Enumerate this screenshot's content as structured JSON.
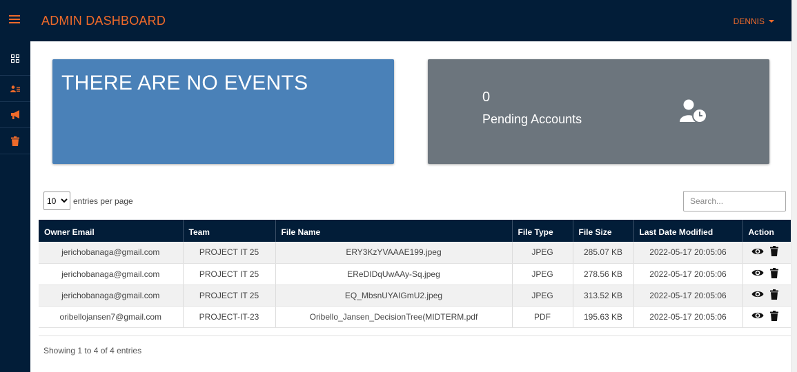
{
  "header": {
    "title": "ADMIN DASHBOARD",
    "user": "DENNIS"
  },
  "sidebar": {
    "items": [
      {
        "icon": "grid-icon"
      },
      {
        "icon": "user-list-icon"
      },
      {
        "icon": "megaphone-icon"
      },
      {
        "icon": "trash-icon"
      }
    ]
  },
  "events_card": {
    "text": "THERE ARE NO EVENTS"
  },
  "pending_card": {
    "count": "0",
    "label": "Pending Accounts",
    "icon": "user-clock-icon"
  },
  "table_controls": {
    "page_size": "10",
    "entries_label": "entries per page",
    "search_placeholder": "Search..."
  },
  "table": {
    "columns": [
      "Owner Email",
      "Team",
      "File Name",
      "File Type",
      "File Size",
      "Last Date Modified",
      "Action"
    ],
    "rows": [
      {
        "email": "jerichobanaga@gmail.com",
        "team": "PROJECT IT 25",
        "file_name": "ERY3KzYVAAAE199.jpeg",
        "file_type": "JPEG",
        "file_size": "285.07 KB",
        "modified": "2022-05-17 20:05:06"
      },
      {
        "email": "jerichobanaga@gmail.com",
        "team": "PROJECT IT 25",
        "file_name": "EReDIDqUwAAy-Sq.jpeg",
        "file_type": "JPEG",
        "file_size": "278.56 KB",
        "modified": "2022-05-17 20:05:06"
      },
      {
        "email": "jerichobanaga@gmail.com",
        "team": "PROJECT IT 25",
        "file_name": "EQ_MbsnUYAIGmU2.jpeg",
        "file_type": "JPEG",
        "file_size": "313.52 KB",
        "modified": "2022-05-17 20:05:06"
      },
      {
        "email": "oribellojansen7@gmail.com",
        "team": "PROJECT-IT-23",
        "file_name": "Oribello_Jansen_DecisionTree(MIDTERM.pdf",
        "file_type": "PDF",
        "file_size": "195.63 KB",
        "modified": "2022-05-17 20:05:06"
      }
    ],
    "info": "Showing 1 to 4 of 4 entries"
  },
  "colors": {
    "navy": "#021d38",
    "accent": "#ee6a2a",
    "events_blue": "#4a81b8",
    "pending_gray": "#6c757d"
  }
}
